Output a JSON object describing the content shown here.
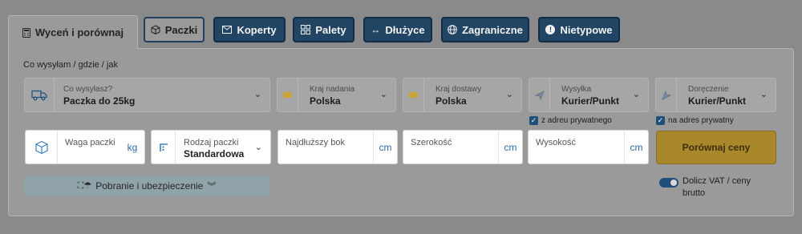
{
  "tabs": [
    {
      "label": "Wyceń i porównaj",
      "icon": "calculator-icon",
      "active": true
    },
    {
      "label": "Paczki",
      "icon": "box-icon"
    },
    {
      "label": "Koperty",
      "icon": "envelope-icon"
    },
    {
      "label": "Palety",
      "icon": "pallet-icon"
    },
    {
      "label": "Dłużyce",
      "icon": "long-arrow-icon"
    },
    {
      "label": "Zagraniczne",
      "icon": "globe-icon"
    },
    {
      "label": "Nietypowe",
      "icon": "exclamation-icon"
    }
  ],
  "form": {
    "section_label": "Co wysyłam / gdzie / jak",
    "what": {
      "label": "Co wysyłasz?",
      "value": "Paczka do 25kg"
    },
    "from_country": {
      "label": "Kraj nadania",
      "value": "Polska"
    },
    "to_country": {
      "label": "Kraj dostawy",
      "value": "Polska"
    },
    "shipping": {
      "label": "Wysyłka",
      "value": "Kurier/Punkt",
      "checkbox_label": "z adreu prywatnego",
      "checked": true
    },
    "delivery": {
      "label": "Doręczenie",
      "value": "Kurier/Punkt",
      "checkbox_label": "na adres prywatny",
      "checked": true
    },
    "weight": {
      "label": "Waga paczki",
      "value": "",
      "unit": "kg"
    },
    "package_type": {
      "label": "Rodzaj paczki",
      "value": "Standardowa"
    },
    "longest_side": {
      "label": "Najdłuższy bok",
      "value": "",
      "unit": "cm"
    },
    "width": {
      "label": "Szerokość",
      "value": "",
      "unit": "cm"
    },
    "height": {
      "label": "Wysokość",
      "value": "",
      "unit": "cm"
    },
    "compare_button": "Porównaj ceny",
    "cod_insurance": "Pobranie i ubezpieczenie",
    "vat_toggle": {
      "label": "Dolicz VAT / ceny brutto",
      "on": true
    }
  },
  "colors": {
    "brand_blue": "#214563",
    "accent_yellow": "#a8882a",
    "checkbox_blue": "#1f4e7a"
  }
}
